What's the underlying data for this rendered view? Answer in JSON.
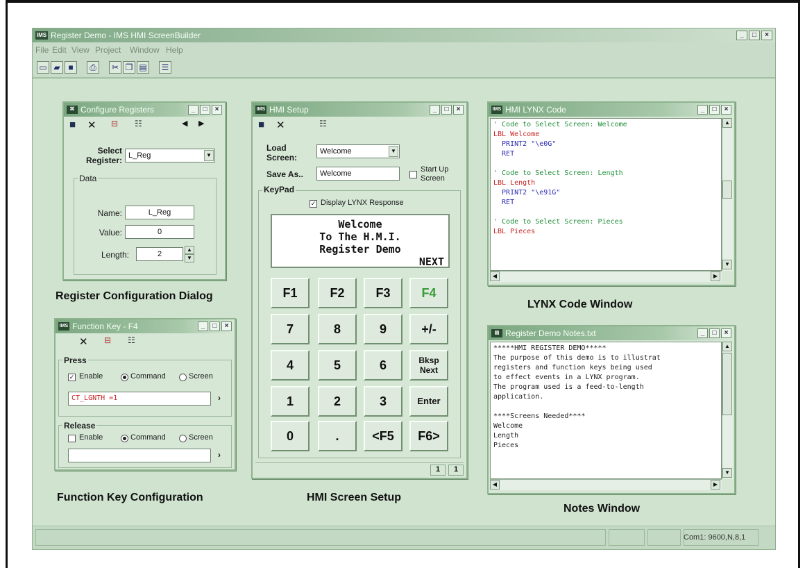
{
  "app": {
    "title": "Register Demo - IMS HMI ScreenBuilder",
    "icon_text": "IMS",
    "menu": [
      "File",
      "Edit",
      "View",
      "Project",
      "Window",
      "Help"
    ],
    "toolbar_icons": [
      "new-icon",
      "open-icon",
      "save-icon",
      "print-icon",
      "cut-icon",
      "copy-icon",
      "paste-icon",
      "properties-icon"
    ],
    "status_text": "Com1: 9600,N,8,1"
  },
  "configure_registers": {
    "title": "Configure Registers",
    "select_register_label": "Select Register:",
    "select_register_value": "L_Reg",
    "data_group": "Data",
    "name_label": "Name:",
    "name_value": "L_Reg",
    "value_label": "Value:",
    "value_value": "0",
    "length_label": "Length:",
    "length_value": "2"
  },
  "function_key": {
    "title": "Function Key - F4",
    "press_group": "Press",
    "press_enable": "Enable",
    "press_command": "Command",
    "press_screen": "Screen",
    "press_value": "CT_LGNTH =1",
    "release_group": "Release",
    "release_enable": "Enable",
    "release_command": "Command",
    "release_screen": "Screen",
    "release_value": ""
  },
  "hmi_setup": {
    "title": "HMI Setup",
    "load_screen_label": "Load Screen:",
    "load_screen_value": "Welcome",
    "save_as_label": "Save As..",
    "save_as_value": "Welcome",
    "startup_label": "Start Up Screen",
    "keypad_group": "KeyPad",
    "display_lynx_label": "Display LYNX Response",
    "display_lines": [
      "Welcome",
      "To The H.M.I.",
      "Register Demo",
      "NEXT"
    ],
    "keys": [
      "F1",
      "F2",
      "F3",
      "F4",
      "7",
      "8",
      "9",
      "+/-",
      "4",
      "5",
      "6",
      "Bksp Next",
      "1",
      "2",
      "3",
      "Enter",
      "0",
      ".",
      "<F5",
      "F6>"
    ],
    "status_cells": [
      "1",
      "1"
    ]
  },
  "lynx_code": {
    "title": "HMI LYNX Code",
    "lines": [
      {
        "text": "' Code to Select Screen: Welcome",
        "kind": "comment"
      },
      {
        "text": "LBL Welcome",
        "kind": "label"
      },
      {
        "text": "  PRINT2 \"\\e0G\"",
        "kind": "keyword"
      },
      {
        "text": "  RET",
        "kind": "keyword"
      },
      {
        "text": "",
        "kind": "plain"
      },
      {
        "text": "' Code to Select Screen: Length",
        "kind": "comment"
      },
      {
        "text": "LBL Length",
        "kind": "label"
      },
      {
        "text": "  PRINT2 \"\\e91G\"",
        "kind": "keyword"
      },
      {
        "text": "  RET",
        "kind": "keyword"
      },
      {
        "text": "",
        "kind": "plain"
      },
      {
        "text": "' Code to Select Screen: Pieces",
        "kind": "comment"
      },
      {
        "text": "LBL Pieces",
        "kind": "label"
      }
    ]
  },
  "notes": {
    "title": "Register Demo Notes.txt",
    "lines": [
      "*****HMI REGISTER DEMO*****",
      "The purpose of this demo is to illustrat",
      "registers and function keys being used",
      "to effect events in a LYNX program.",
      "The program used is a feed-to-length",
      "application.",
      "",
      "****Screens Needed****",
      "Welcome",
      "Length",
      "Pieces"
    ]
  },
  "captions": {
    "register_config": "Register Configuration Dialog",
    "function_key": "Function Key Configuration",
    "hmi_setup": "HMI Screen Setup",
    "lynx_code": "LYNX Code Window",
    "notes": "Notes Window"
  }
}
